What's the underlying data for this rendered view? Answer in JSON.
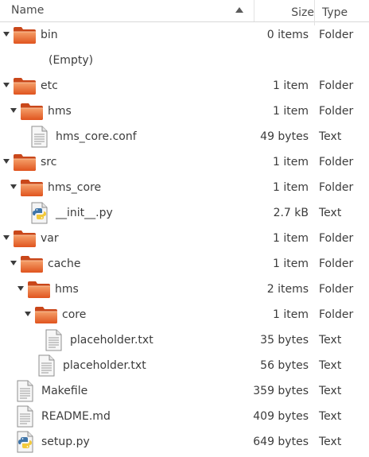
{
  "columns": {
    "name": "Name",
    "size": "Size",
    "type": "Type"
  },
  "rows": [
    {
      "kind": "folder",
      "depth": 0,
      "name": "bin",
      "size": "0 items",
      "type": "Folder",
      "expanded": true
    },
    {
      "kind": "empty",
      "depth": 1,
      "name": "(Empty)",
      "size": "",
      "type": ""
    },
    {
      "kind": "folder",
      "depth": 0,
      "name": "etc",
      "size": "1 item",
      "type": "Folder",
      "expanded": true
    },
    {
      "kind": "folder",
      "depth": 1,
      "name": "hms",
      "size": "1 item",
      "type": "Folder",
      "expanded": true
    },
    {
      "kind": "text",
      "depth": 2,
      "name": "hms_core.conf",
      "size": "49 bytes",
      "type": "Text"
    },
    {
      "kind": "folder",
      "depth": 0,
      "name": "src",
      "size": "1 item",
      "type": "Folder",
      "expanded": true
    },
    {
      "kind": "folder",
      "depth": 1,
      "name": "hms_core",
      "size": "1 item",
      "type": "Folder",
      "expanded": true
    },
    {
      "kind": "python",
      "depth": 2,
      "name": "__init__.py",
      "size": "2.7 kB",
      "type": "Text"
    },
    {
      "kind": "folder",
      "depth": 0,
      "name": "var",
      "size": "1 item",
      "type": "Folder",
      "expanded": true
    },
    {
      "kind": "folder",
      "depth": 1,
      "name": "cache",
      "size": "1 item",
      "type": "Folder",
      "expanded": true
    },
    {
      "kind": "folder",
      "depth": 2,
      "name": "hms",
      "size": "2 items",
      "type": "Folder",
      "expanded": true
    },
    {
      "kind": "folder",
      "depth": 3,
      "name": "core",
      "size": "1 item",
      "type": "Folder",
      "expanded": true
    },
    {
      "kind": "text",
      "depth": 4,
      "name": "placeholder.txt",
      "size": "35 bytes",
      "type": "Text"
    },
    {
      "kind": "text",
      "depth": 3,
      "name": "placeholder.txt",
      "size": "56 bytes",
      "type": "Text"
    },
    {
      "kind": "text",
      "depth": 0,
      "name": "Makefile",
      "size": "359 bytes",
      "type": "Text"
    },
    {
      "kind": "text",
      "depth": 0,
      "name": "README.md",
      "size": "409 bytes",
      "type": "Text"
    },
    {
      "kind": "python",
      "depth": 0,
      "name": "setup.py",
      "size": "649 bytes",
      "type": "Text"
    }
  ]
}
